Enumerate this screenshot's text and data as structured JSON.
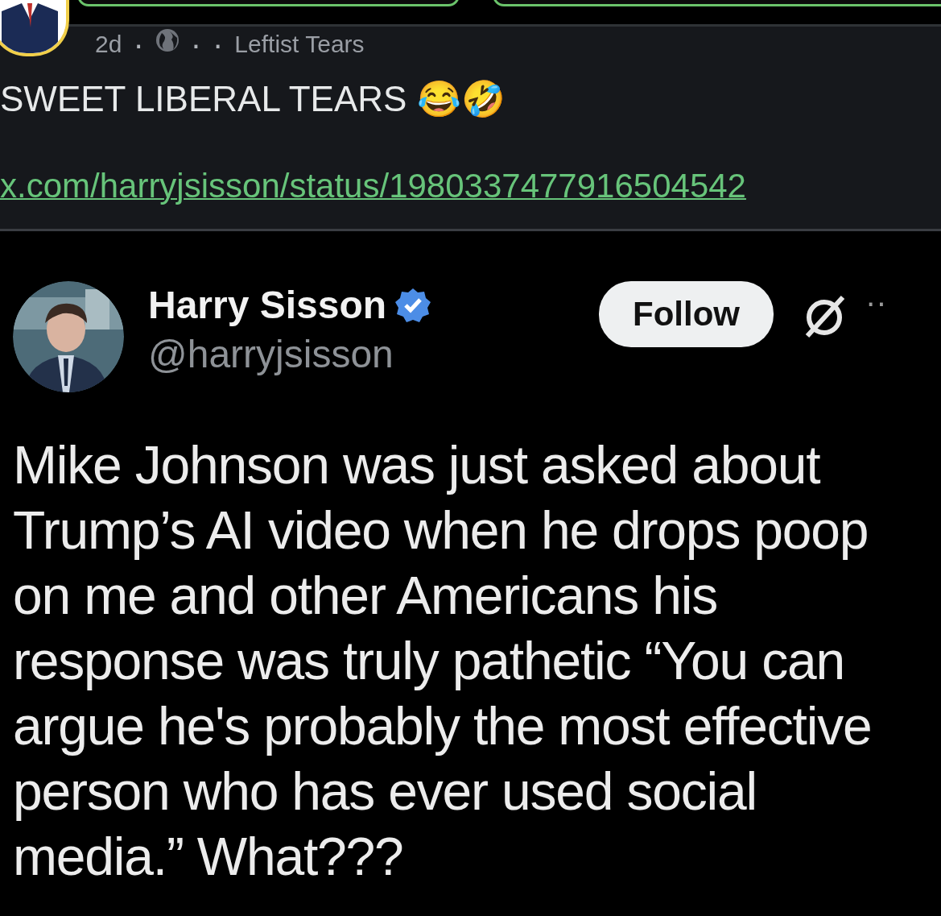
{
  "post": {
    "meta": {
      "time": "2d",
      "separators": [
        "·",
        "·",
        "·"
      ],
      "group": "Leftist Tears"
    },
    "text": "SWEET LIBERAL TEARS 😂🤣",
    "link": "x.com/harryjsisson/status/1980337477916504542"
  },
  "embedded_tweet": {
    "author": {
      "name": "Harry Sisson",
      "verified": true,
      "handle": "@harryjsisson"
    },
    "follow_button": "Follow",
    "more": "··",
    "text": "Mike Johnson was just asked about Trump’s AI video when he drops poop on me and other Americans his response was truly pathetic “You can argue he's probably the most effective person who has ever used social media.” What???"
  }
}
